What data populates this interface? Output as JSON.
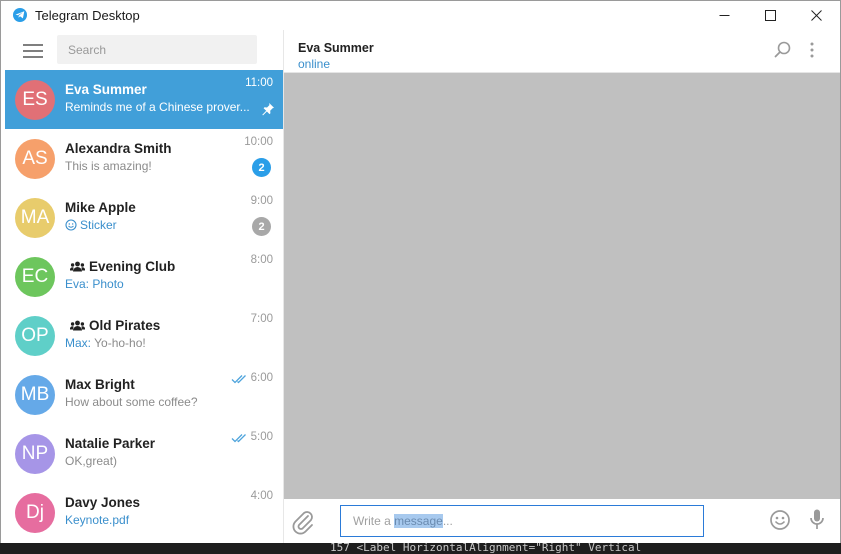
{
  "window": {
    "title": "Telegram Desktop",
    "accent": "#419fd9"
  },
  "sidebar": {
    "search_placeholder": "Search",
    "chats": [
      {
        "initials": "ES",
        "name": "Eva Summer",
        "time": "11:00",
        "preview_accent": "",
        "preview": "Reminds me of a Chinese prover...",
        "avatar_color": "#e17076",
        "active": true,
        "pinned": true,
        "badge": "",
        "group": false,
        "read": false,
        "sticker": false
      },
      {
        "initials": "AS",
        "name": "Alexandra Smith",
        "time": "10:00",
        "preview_accent": "",
        "preview": "This is amazing!",
        "avatar_color": "#f6a06b",
        "active": false,
        "pinned": false,
        "badge": "2",
        "badge_color": "#2a9ee8",
        "group": false,
        "read": false,
        "sticker": false
      },
      {
        "initials": "MA",
        "name": "Mike Apple",
        "time": "9:00",
        "preview_accent": "Sticker",
        "preview": "",
        "avatar_color": "#e8cc6c",
        "active": false,
        "pinned": false,
        "badge": "2",
        "badge_color": "#a8a8a8",
        "group": false,
        "read": false,
        "sticker": true
      },
      {
        "initials": "EC",
        "name": "Evening Club",
        "time": "8:00",
        "preview_accent": "Eva: Photo",
        "preview": "",
        "avatar_color": "#6dc65d",
        "active": false,
        "pinned": false,
        "badge": "",
        "group": true,
        "read": false,
        "sticker": false
      },
      {
        "initials": "OP",
        "name": "Old Pirates",
        "time": "7:00",
        "preview_accent": "Max:",
        "preview": " Yo-ho-ho!",
        "avatar_color": "#5fcfc8",
        "active": false,
        "pinned": false,
        "badge": "",
        "group": true,
        "read": false,
        "sticker": false
      },
      {
        "initials": "MB",
        "name": "Max Bright",
        "time": "6:00",
        "preview_accent": "",
        "preview": "How about some coffee?",
        "avatar_color": "#65a9e8",
        "active": false,
        "pinned": false,
        "badge": "",
        "group": false,
        "read": true,
        "sticker": false
      },
      {
        "initials": "NP",
        "name": "Natalie Parker",
        "time": "5:00",
        "preview_accent": "",
        "preview": "OK,great)",
        "avatar_color": "#a695e7",
        "active": false,
        "pinned": false,
        "badge": "",
        "group": false,
        "read": true,
        "sticker": false
      },
      {
        "initials": "Dj",
        "name": "Davy Jones",
        "time": "4:00",
        "preview_accent": "Keynote.pdf",
        "preview": "",
        "avatar_color": "#e66d9f",
        "active": false,
        "pinned": false,
        "badge": "",
        "group": false,
        "read": false,
        "sticker": false
      }
    ]
  },
  "chat": {
    "peer_name": "Eva Summer",
    "peer_status": "online",
    "input_placeholder_a": "Write a ",
    "input_placeholder_b": "message",
    "input_placeholder_c": "..."
  },
  "background": {
    "code_snippet": "157    <Label HorizontalAlignment=\"Right\" Vertical"
  }
}
